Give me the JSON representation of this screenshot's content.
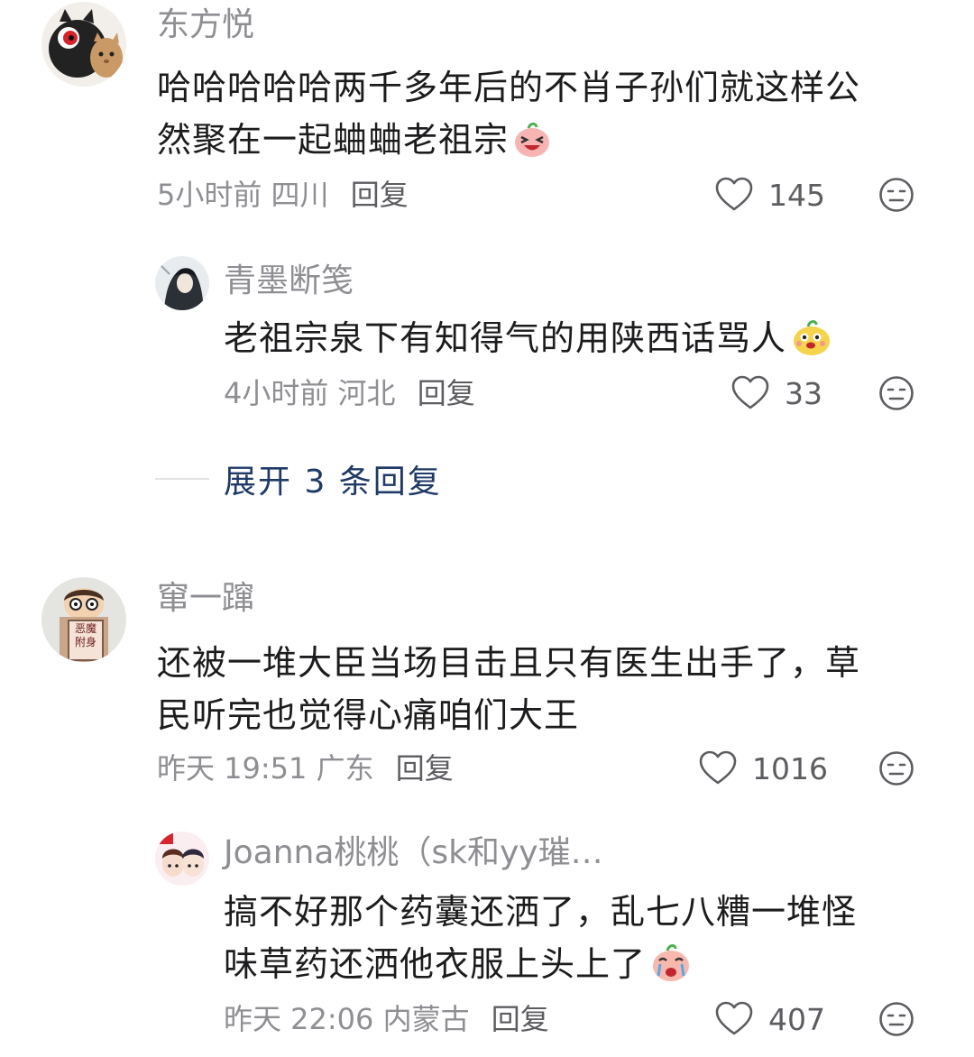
{
  "comments": [
    {
      "username": "东方悦",
      "lines": [
        "哈哈哈哈哈两千多年后的不肖子孙们就这样公",
        "然聚在一起蛐蛐老祖宗"
      ],
      "emoji": "laughing-face-emoji",
      "time": "5小时前",
      "location": "四川",
      "reply_label": "回复",
      "likes": "145",
      "reply": {
        "username": "青墨断笺",
        "lines": [
          "老祖宗泉下有知得气的用陕西话骂人"
        ],
        "emoji": "smiling-face-emoji",
        "time": "4小时前",
        "location": "河北",
        "reply_label": "回复",
        "likes": "33"
      },
      "expand_label": "展开 3 条回复"
    },
    {
      "username": "窜一蹿",
      "lines": [
        "还被一堆大臣当场目击且只有医生出手了，草",
        "民听完也觉得心痛咱们大王"
      ],
      "time": "昨天 19:51",
      "location": "广东",
      "reply_label": "回复",
      "likes": "1016",
      "avatar_text": "恶魔附身",
      "reply": {
        "username": "Joanna桃桃（sk和yy璀…",
        "lines": [
          "搞不好那个药囊还洒了，乱七八糟一堆怪",
          "味草药还洒他衣服上头上了"
        ],
        "emoji": "crying-face-emoji",
        "time": "昨天 22:06",
        "location": "内蒙古",
        "reply_label": "回复",
        "likes": "407"
      }
    }
  ],
  "colors": {
    "username": "#8e8e93",
    "content": "#1c1c1e",
    "expand": "#1f3a66",
    "icon": "#5c5c61"
  }
}
